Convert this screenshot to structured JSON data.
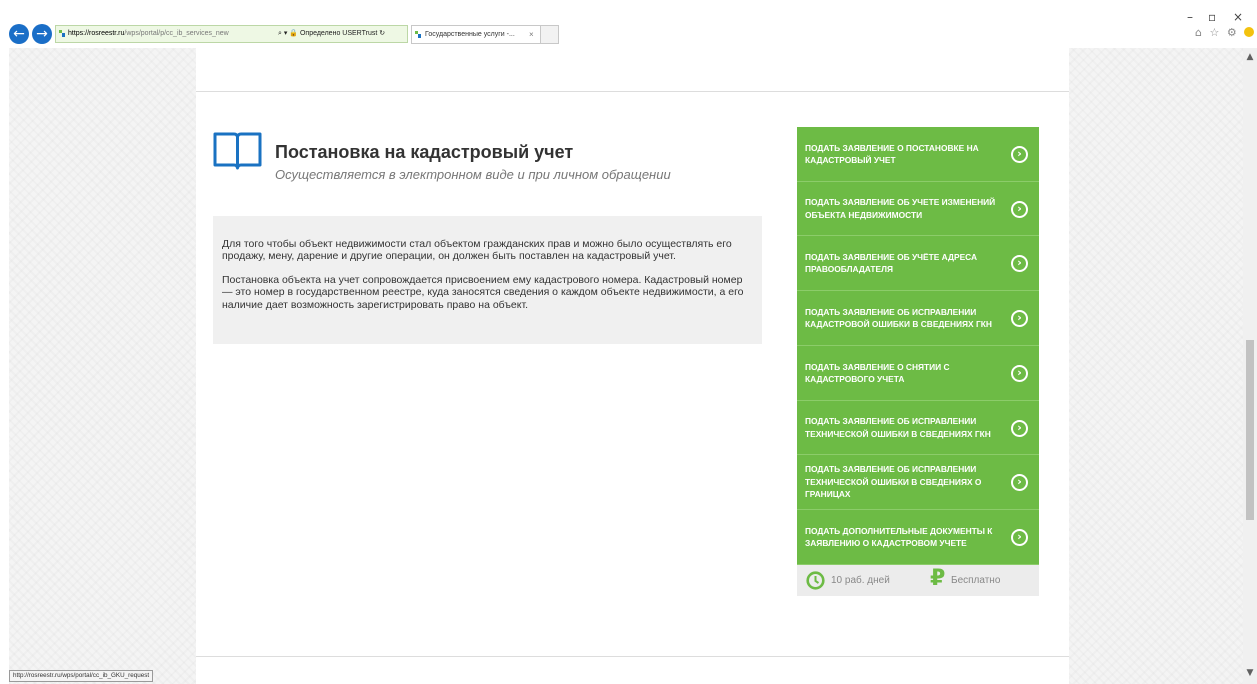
{
  "browser": {
    "address_url_host": "https://rosreestr.ru",
    "address_url_path": "/wps/portal/p/cc_ib_services_new",
    "address_tools": "⌕ ▾ 🔒 Определено USERTrust ↻",
    "tab_title": "Государственные услуги -...",
    "tab_close": "×",
    "minimize": "–",
    "maximize": "▫",
    "close": "×",
    "toolbar_icons": "⌂ ☆ ⚙",
    "status_url": "http://rosreestr.ru/wps/portal/cc_ib_GKU_request"
  },
  "main": {
    "title": "Постановка на кадастровый учет",
    "subtitle": "Осуществляется в электронном виде и при личном обращении",
    "paragraphs": [
      "Для того чтобы объект недвижимости стал объектом гражданских прав и можно было осуществлять его продажу, мену, дарение и другие операции, он должен быть поставлен на кадастровый учет.",
      "Постановка объекта на учет сопровождается присвоением ему кадастрового номера. Кадастровый номер — это номер в государственном реестре, куда заносятся сведения о каждом объекте недвижимости, а его наличие дает возможность зарегистрировать право на объект."
    ]
  },
  "services": [
    {
      "label": "Подать заявление о постановке на кадастровый учет"
    },
    {
      "label": "Подать заявление об учете изменений объекта недвижимости"
    },
    {
      "label": "Подать заявление об учёте адреса правообладателя"
    },
    {
      "label": "Подать заявление об исправлении кадастровой ошибки в сведениях ГКН"
    },
    {
      "label": "Подать заявление о снятии с кадастрового учета"
    },
    {
      "label": "Подать заявление об исправлении технической ошибки в сведениях ГКН"
    },
    {
      "label": "Подать заявление об исправлении технической ошибки в сведениях о границах"
    },
    {
      "label": "Подать дополнительные документы к заявлению о кадастровом учете"
    }
  ],
  "footer": {
    "days": "10 раб. дней",
    "currency_symbol": "₽",
    "price": "Бесплатно"
  },
  "colors": {
    "accent_green": "#6dbb45",
    "icon_blue": "#1a72c2"
  },
  "icons": {
    "back": "←",
    "forward": "→",
    "arrow": "›",
    "scroll_up": "▲",
    "scroll_down": "▼"
  }
}
